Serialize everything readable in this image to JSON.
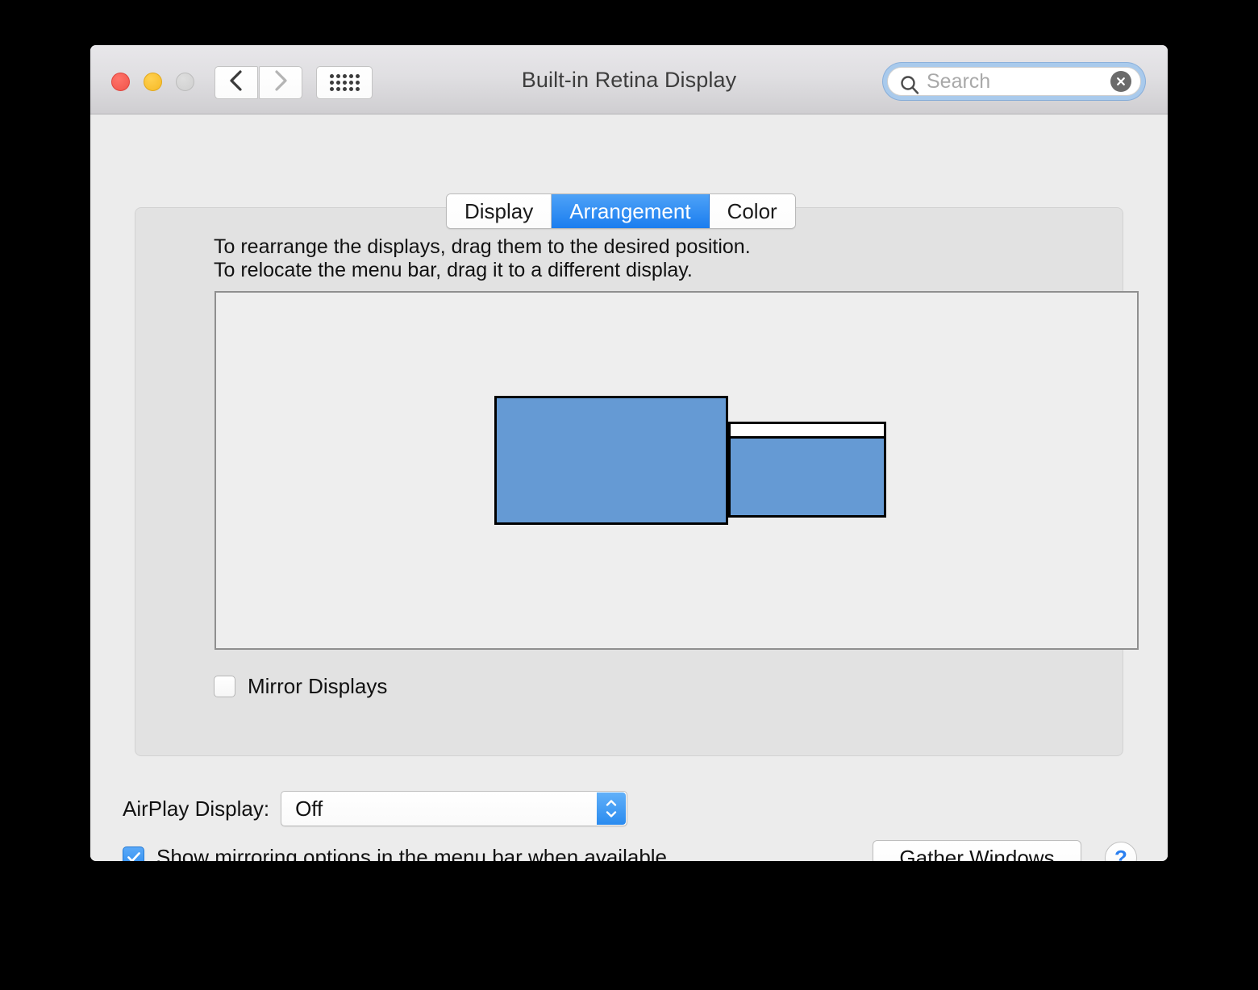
{
  "window": {
    "title": "Built-in Retina Display",
    "traffic_lights": {
      "close": "close-button",
      "minimize": "minimize-button",
      "zoom": "zoom-button"
    }
  },
  "toolbar": {
    "back_icon": "chevron-left-icon",
    "forward_icon": "chevron-right-icon",
    "show_all_icon": "grid-dots-icon",
    "search": {
      "placeholder": "Search",
      "value": "",
      "icon": "search-icon",
      "clear_icon": "clear-circle-icon"
    }
  },
  "tabs": [
    {
      "label": "Display",
      "selected": false
    },
    {
      "label": "Arrangement",
      "selected": true
    },
    {
      "label": "Color",
      "selected": false
    }
  ],
  "arrangement": {
    "instructions": "To rearrange the displays, drag them to the desired position.\nTo relocate the menu bar, drag it to a different display.",
    "displays": [
      {
        "name": "primary-display",
        "has_menu_bar": false
      },
      {
        "name": "secondary-display",
        "has_menu_bar": true
      }
    ],
    "mirror": {
      "label": "Mirror Displays",
      "checked": false
    }
  },
  "airplay": {
    "label": "AirPlay Display:",
    "value": "Off",
    "options": [
      "Off"
    ]
  },
  "footer": {
    "show_mirroring": {
      "label": "Show mirroring options in the menu bar when available",
      "checked": true
    },
    "gather_windows_label": "Gather Windows",
    "help_label": "?"
  },
  "colors": {
    "accent": "#1a7def",
    "display_fill": "#659ad4",
    "window_bg": "#ececec",
    "panel_bg": "#e2e2e2"
  }
}
